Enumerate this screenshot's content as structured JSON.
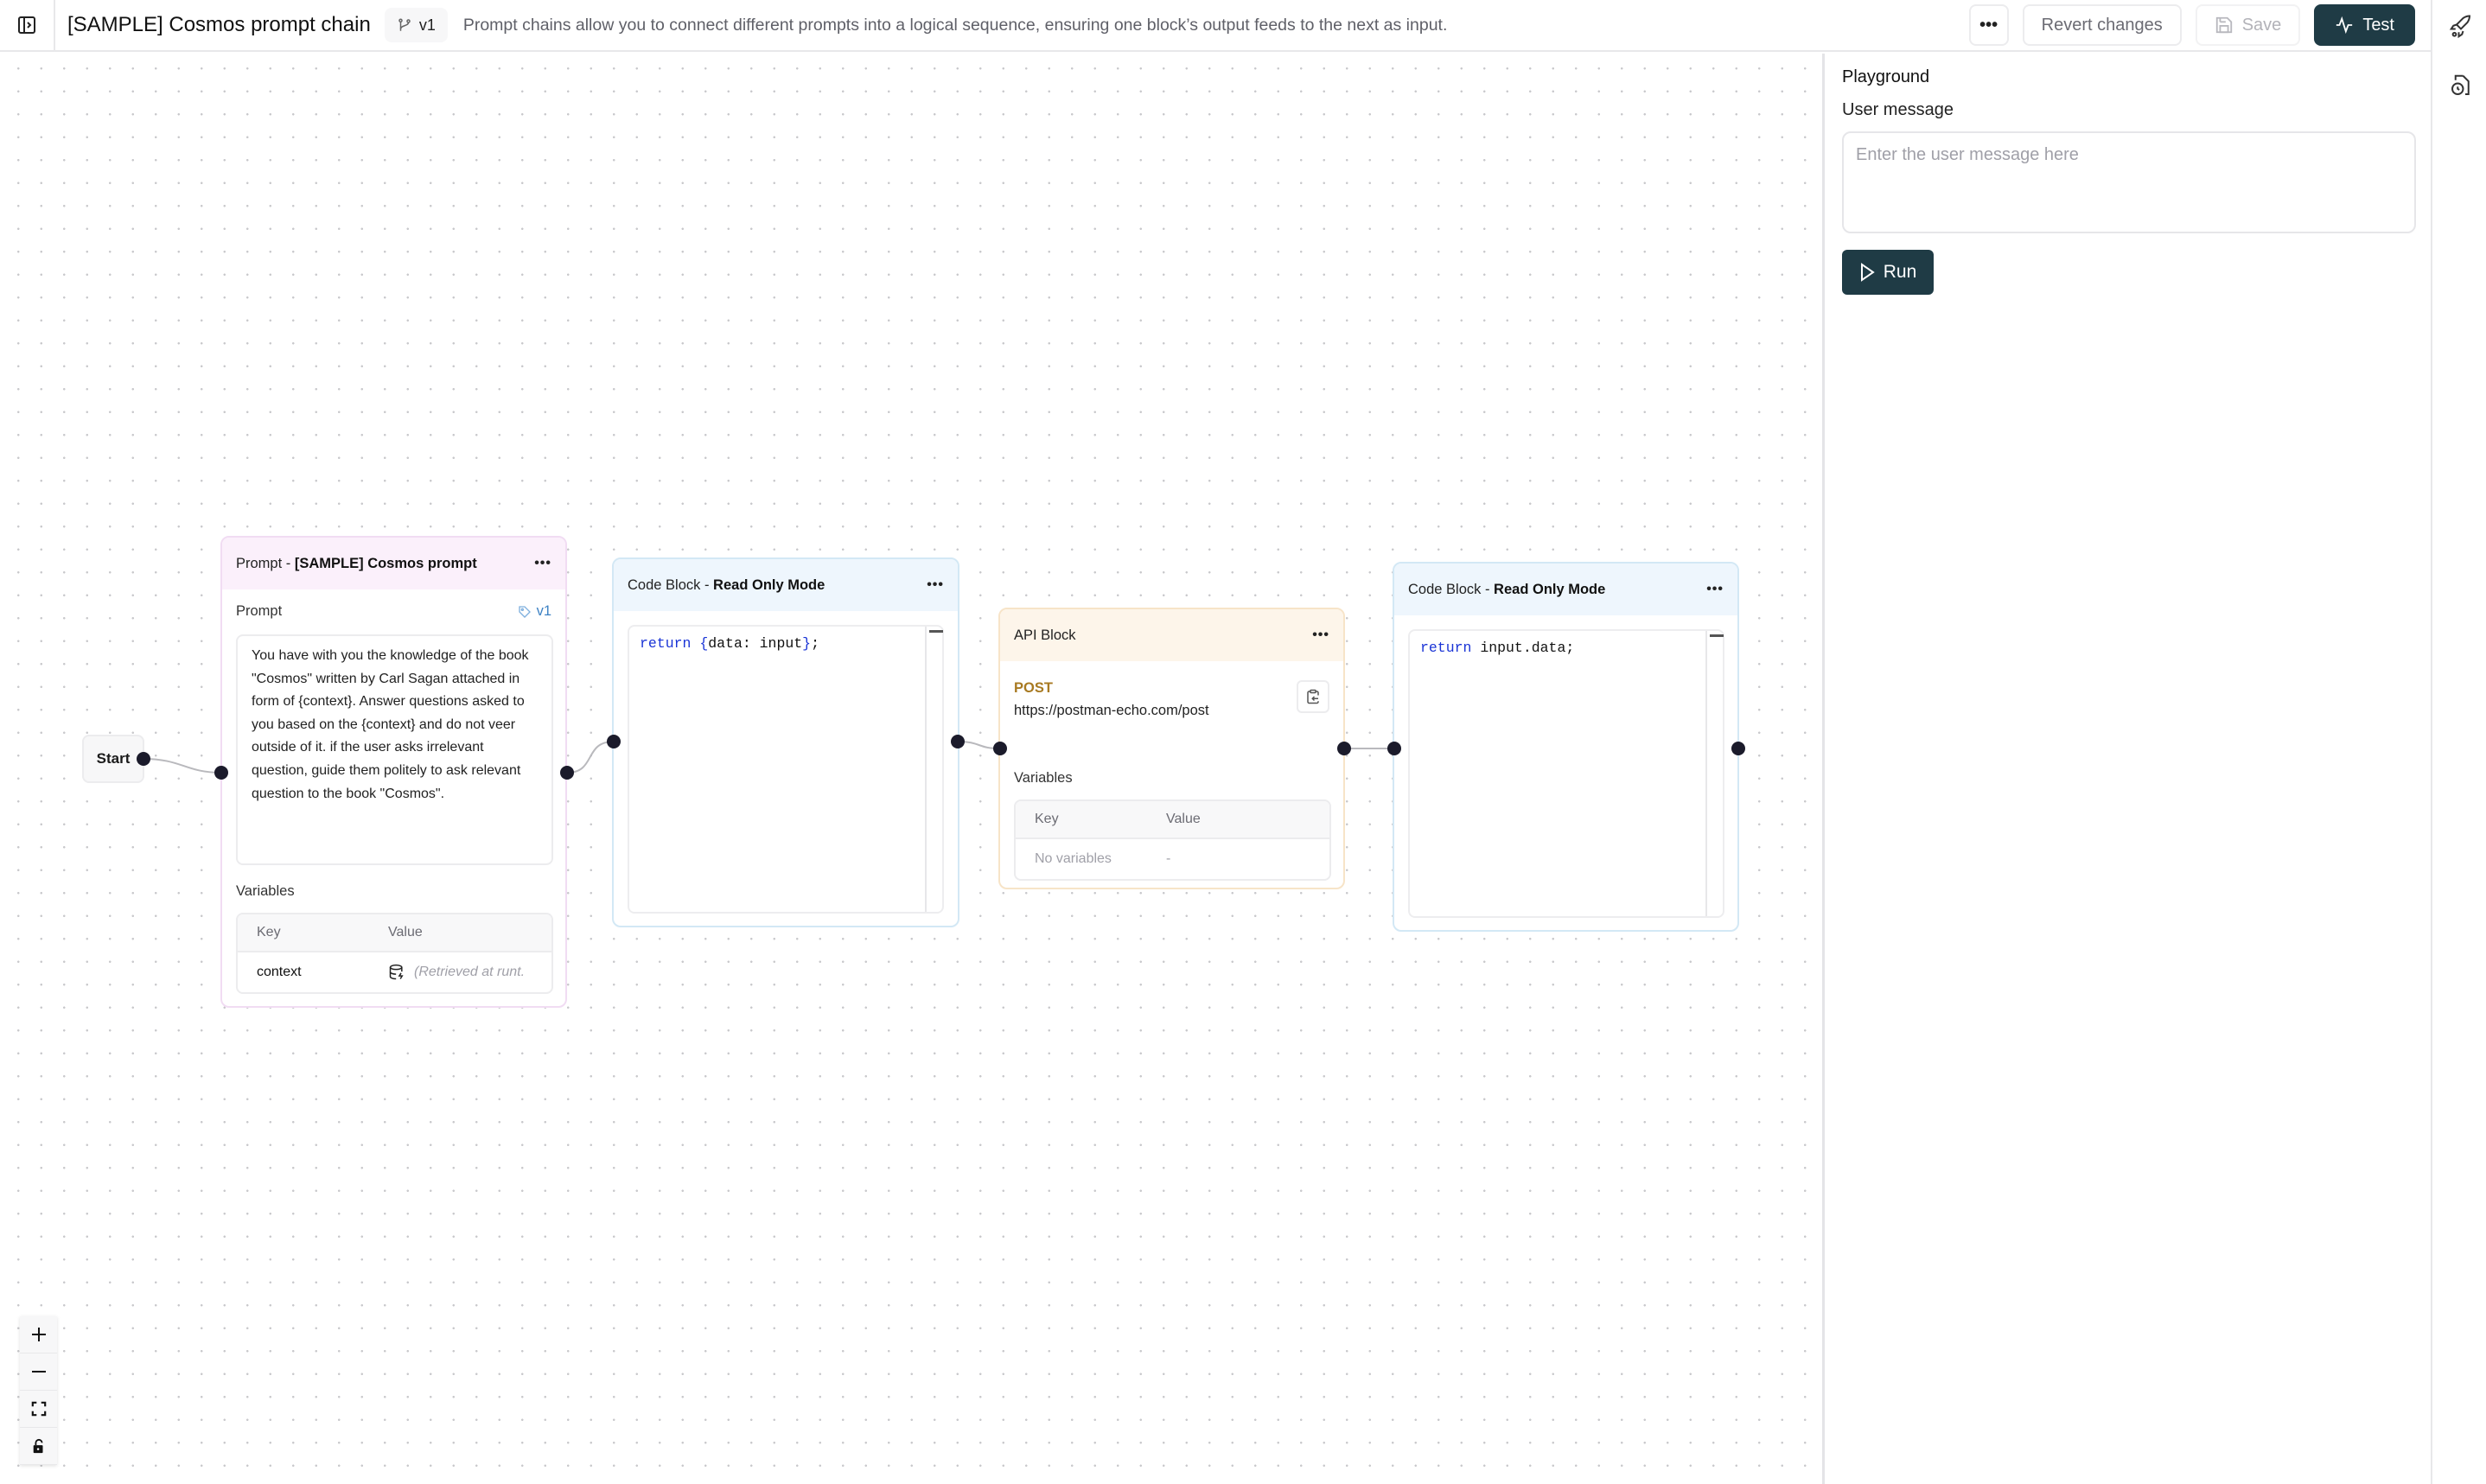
{
  "header": {
    "title": "[SAMPLE] Cosmos prompt chain",
    "version": "v1",
    "description": "Prompt chains allow you to connect different prompts into a logical sequence, ensuring one block’s output feeds to the next as input.",
    "more_label": "•••",
    "revert_label": "Revert changes",
    "save_label": "Save",
    "test_label": "Test"
  },
  "playground": {
    "title": "Playground",
    "user_message_label": "User message",
    "user_message_placeholder": "Enter the user message here",
    "user_message_value": "",
    "run_label": "Run"
  },
  "canvas": {
    "start_label": "Start",
    "prompt_node": {
      "title_prefix": "Prompt - ",
      "title_name": "[SAMPLE] Cosmos prompt",
      "section_label": "Prompt",
      "version_tag": "v1",
      "prompt_text": "You have with you the knowledge of the book \"Cosmos\" written by Carl Sagan attached in form of {context}. Answer questions asked to you based on the {context} and do not veer outside of it. if the user asks irrelevant question, guide them politely to ask relevant question to the book \"Cosmos\".",
      "variables_label": "Variables",
      "key_header": "Key",
      "value_header": "Value",
      "variables": [
        {
          "key": "context",
          "value": "(Retrieved at runt."
        }
      ]
    },
    "code_node_1": {
      "title_prefix": "Code Block - ",
      "title_mode": "Read Only Mode",
      "code_keyword": "return",
      "code_open": "{",
      "code_body": "data: input",
      "code_close": "}",
      "code_end": ";"
    },
    "api_node": {
      "title": "API Block",
      "method": "POST",
      "url": "https://postman-echo.com/post",
      "variables_label": "Variables",
      "key_header": "Key",
      "value_header": "Value",
      "empty_key": "No variables",
      "empty_value": "-"
    },
    "code_node_2": {
      "title_prefix": "Code Block - ",
      "title_mode": "Read Only Mode",
      "code_keyword": "return",
      "code_body": " input.data;"
    },
    "node_menu_label": "•••"
  },
  "colors": {
    "primary": "#1f3b45",
    "code_keyword": "#1a34d6",
    "post_method": "#a87a22",
    "version_tag": "#3d82c4"
  }
}
